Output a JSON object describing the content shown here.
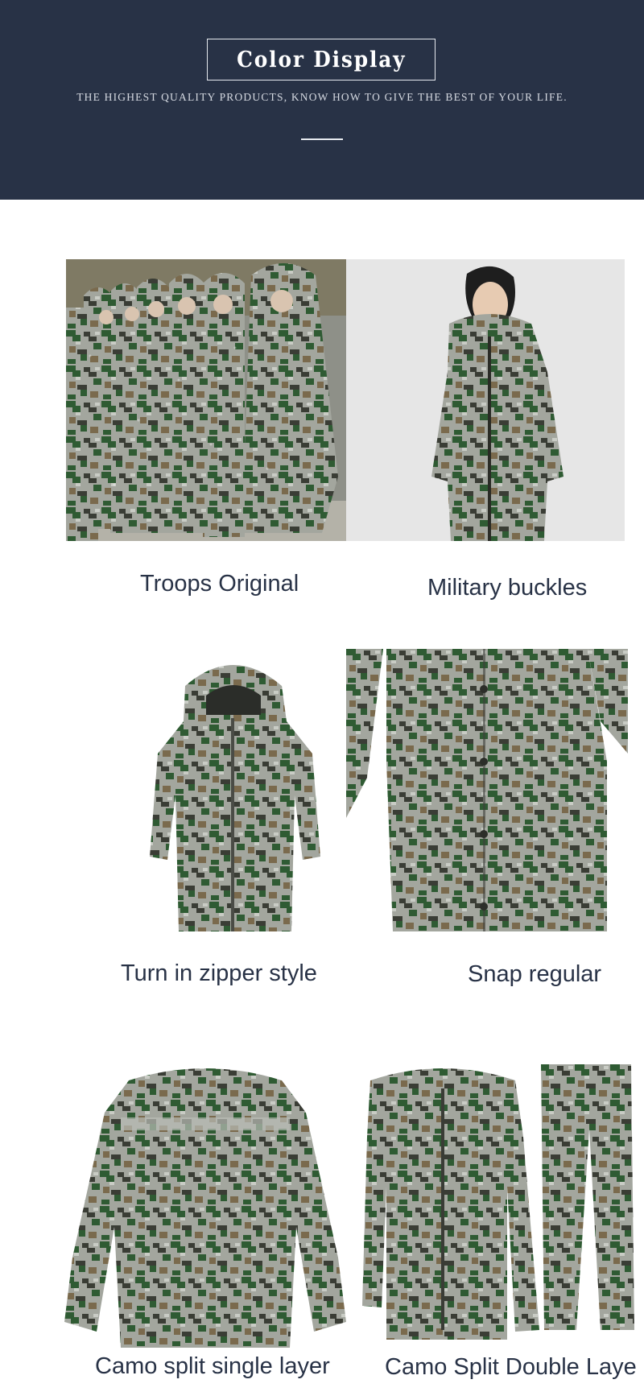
{
  "header": {
    "title": "Color Display",
    "tagline": "THE HIGHEST QUALITY PRODUCTS, KNOW HOW TO GIVE THE BEST OF YOUR LIFE.",
    "background_color": "#283246"
  },
  "products": [
    {
      "caption": "Troops Original",
      "image": "soldiers-marching-in-camo-raincoats"
    },
    {
      "caption": "Military buckles",
      "image": "model-wearing-camo-raincoat"
    },
    {
      "caption": "Turn in zipper style",
      "image": "hooded-camo-long-raincoat"
    },
    {
      "caption": "Snap regular",
      "image": "camo-raincoat-snap-closeup"
    },
    {
      "caption": "Camo split single layer",
      "image": "camo-rain-jacket-back"
    },
    {
      "caption": "Camo Split Double Laye",
      "image": "camo-jacket-and-pants-set"
    }
  ],
  "colors": {
    "caption_text": "#283246",
    "camo_light": "#a9aca4",
    "camo_green": "#2f5b33",
    "camo_dark": "#3a3d35",
    "camo_brown": "#7a6a4d"
  }
}
